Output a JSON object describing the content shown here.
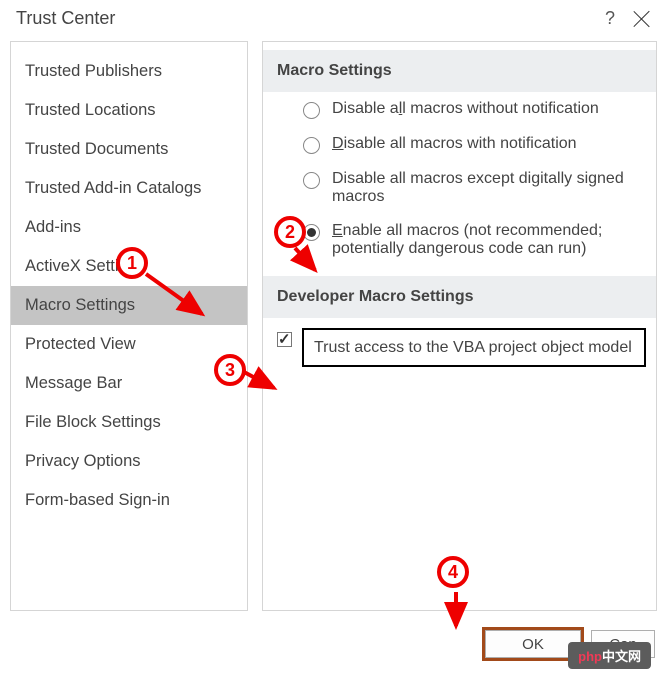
{
  "title": "Trust Center",
  "help_symbol": "?",
  "sidebar": {
    "items": [
      {
        "label": "Trusted Publishers"
      },
      {
        "label": "Trusted Locations"
      },
      {
        "label": "Trusted Documents"
      },
      {
        "label": "Trusted Add-in Catalogs"
      },
      {
        "label": "Add-ins"
      },
      {
        "label": "ActiveX Settings"
      },
      {
        "label": "Macro Settings"
      },
      {
        "label": "Protected View"
      },
      {
        "label": "Message Bar"
      },
      {
        "label": "File Block Settings"
      },
      {
        "label": "Privacy Options"
      },
      {
        "label": "Form-based Sign-in"
      }
    ],
    "selected_index": 6
  },
  "content": {
    "section1_header": "Macro Settings",
    "radios": [
      {
        "pre": "Disable a",
        "u": "l",
        "post": "l macros without notification"
      },
      {
        "pre": "",
        "u": "D",
        "post": "isable all macros with notification"
      },
      {
        "pre": "Disable all macros except di",
        "u": "g",
        "post": "itally signed macros"
      },
      {
        "pre": "",
        "u": "E",
        "post": "nable all macros (not recommended; potentially dangerous code can run)"
      }
    ],
    "selected_radio": 3,
    "section2_header": "Developer Macro Settings",
    "checkbox": {
      "checked": true,
      "pre": "Trust access to the ",
      "u": "V",
      "post": "BA project object model"
    }
  },
  "buttons": {
    "ok": "OK",
    "cancel": "Can"
  },
  "watermark": {
    "a": "php",
    "b": "中文网"
  },
  "annotations": {
    "n1": "1",
    "n2": "2",
    "n3": "3",
    "n4": "4"
  }
}
